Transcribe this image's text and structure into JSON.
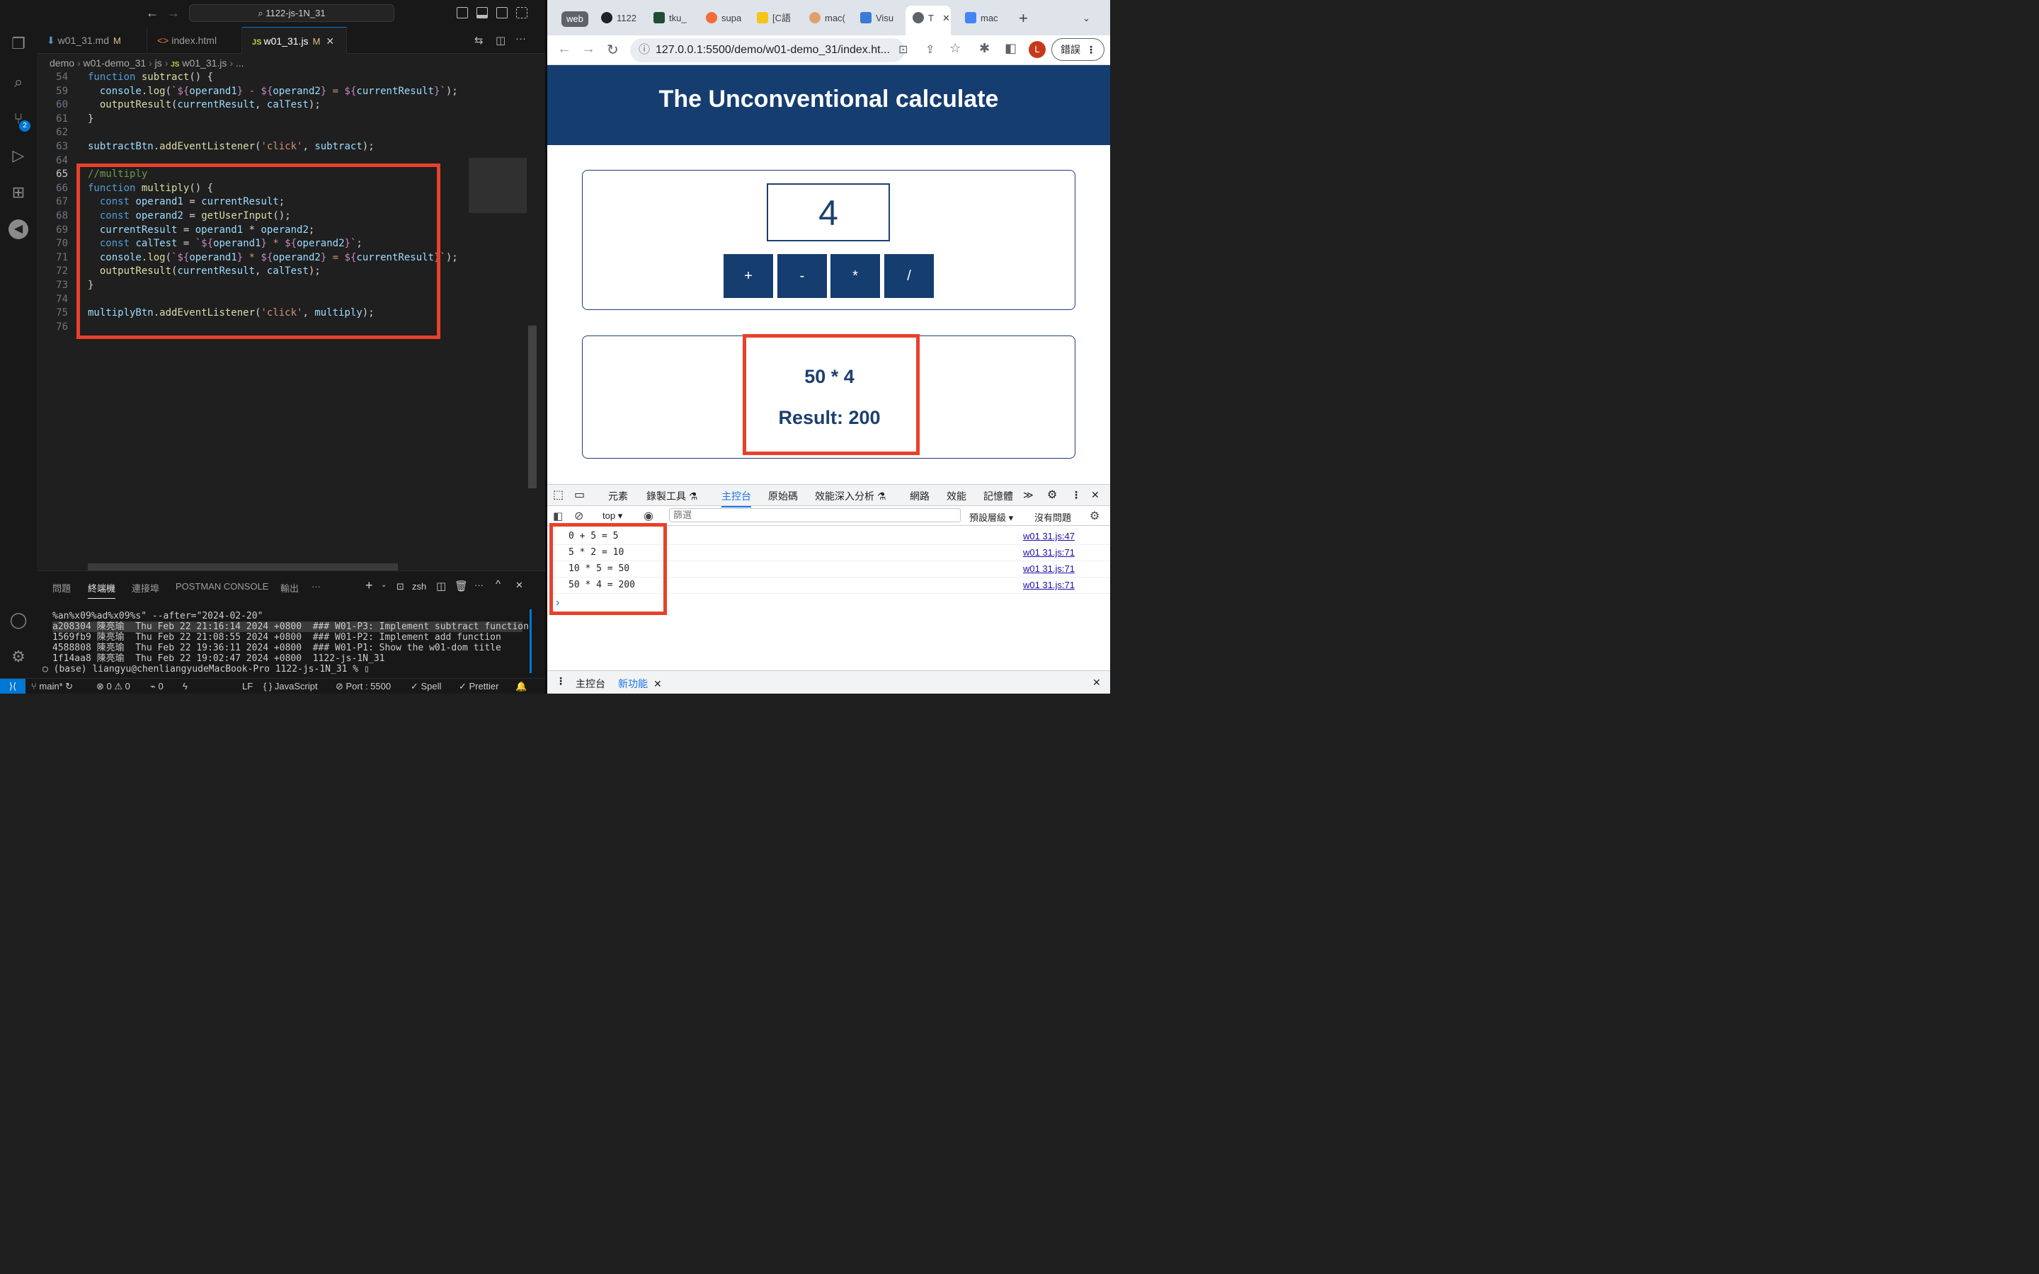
{
  "vscode": {
    "search": "1122-js-1N_31",
    "tabs": [
      {
        "label": "w01_31.md",
        "mod": "M"
      },
      {
        "label": "index.html",
        "mod": ""
      },
      {
        "label": "w01_31.js",
        "mod": "M"
      }
    ],
    "badge": "2",
    "breadcrumb": [
      "demo",
      "w01-demo_31",
      "js",
      "w01_31.js",
      "..."
    ],
    "line_numbers": [
      "54",
      "59",
      "60",
      "61",
      "62",
      "63",
      "64",
      "65",
      "66",
      "67",
      "68",
      "69",
      "70",
      "71",
      "72",
      "73",
      "74",
      "75",
      "76"
    ],
    "panel_tabs": [
      "問題",
      "終端機",
      "連接埠",
      "POSTMAN CONSOLE",
      "輸出",
      "···"
    ],
    "shell": "zsh",
    "terminal": [
      "%an%x09%ad%x09%s\" --after=\"2024-02-20\"",
      "a208304 陳亮瑜  Thu Feb 22 21:16:14 2024 +0800  ### W01-P3: Implement subtract function",
      "1569fb9 陳亮瑜  Thu Feb 22 21:08:55 2024 +0800  ### W01-P2: Implement add function",
      "4588808 陳亮瑜  Thu Feb 22 19:36:11 2024 +0800  ### W01-P1: Show the w01-dom title",
      "1f14aa8 陳亮瑜  Thu Feb 22 19:02:47 2024 +0800  1122-js-1N_31",
      "○ (base) liangyu@chenliangyudeMacBook-Pro 1122-js-1N_31 % ▯"
    ],
    "status": {
      "branch": "main*",
      "errors": "⊗ 0 ⚠ 0",
      "ports": "0",
      "eol": "LF",
      "lang": "{ } JavaScript",
      "port": "⊘ Port : 5500",
      "spell": "✓ Spell",
      "prettier": "✓ Prettier"
    }
  },
  "browser": {
    "tabs": [
      "web",
      "1122",
      "tku_",
      "supa",
      "[C語",
      "mac(",
      "Visu",
      "T",
      "mac"
    ],
    "url": "127.0.0.1:5500/demo/w01-demo_31/index.ht...",
    "avatar": "L",
    "error_button": "錯誤",
    "page": {
      "title": "The Unconventional calculate",
      "display_value": "4",
      "operators": [
        "+",
        "-",
        "*",
        "/"
      ],
      "expression": "50 * 4",
      "result": "Result: 200"
    },
    "devtools": {
      "tabs": [
        "元素",
        "錄製工具 ⚗",
        "主控台",
        "原始碼",
        "效能深入分析 ⚗",
        "網路",
        "效能",
        "記憶體",
        "≫"
      ],
      "context": "top",
      "filter_placeholder": "篩選",
      "levels": "預設層級",
      "issues": "沒有問題",
      "console": [
        {
          "msg": "0 + 5 = 5",
          "src": "w01 31.js:47"
        },
        {
          "msg": "5 * 2 = 10",
          "src": "w01 31.js:71"
        },
        {
          "msg": "10 * 5 = 50",
          "src": "w01 31.js:71"
        },
        {
          "msg": "50 * 4 = 200",
          "src": "w01 31.js:71"
        }
      ],
      "prompt": "›",
      "drawer_tabs": [
        "主控台",
        "新功能"
      ]
    }
  },
  "colors": {
    "header": "#153d6f",
    "highlight": "#e8412b",
    "vs_accent": "#0078d4"
  }
}
